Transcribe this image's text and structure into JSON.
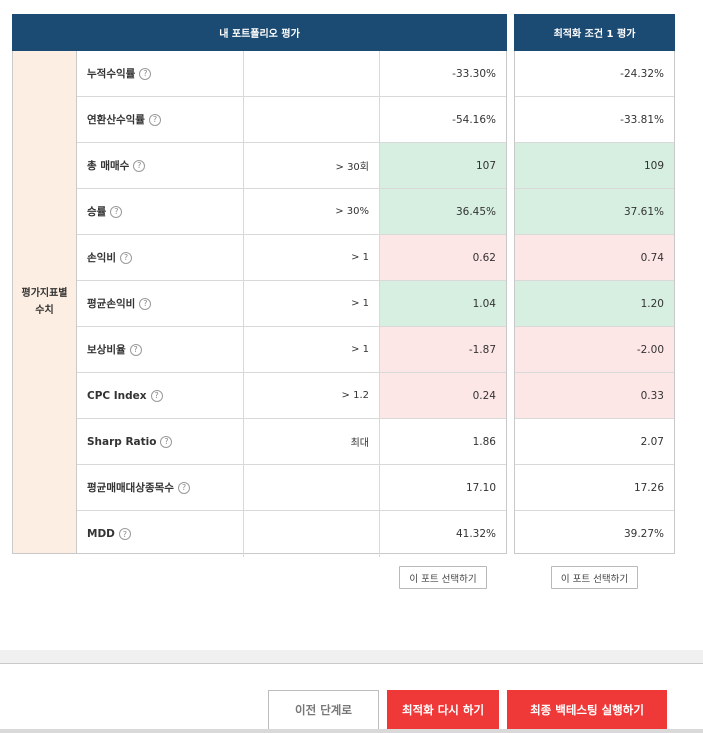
{
  "headers": {
    "my_portfolio": "내 포트폴리오 평가",
    "optimized": "최적화 조건 1 평가"
  },
  "side_label": "평가지표별\n수치",
  "help_glyph": "?",
  "rows": [
    {
      "name": "누적수익률",
      "criteria": "",
      "value": "-33.30%",
      "opt_value": "-24.32%",
      "color": ""
    },
    {
      "name": "연환산수익률",
      "criteria": "",
      "value": "-54.16%",
      "opt_value": "-33.81%",
      "color": ""
    },
    {
      "name": "총 매매수",
      "criteria": "> 30회",
      "value": "107",
      "opt_value": "109",
      "color": "green"
    },
    {
      "name": "승률",
      "criteria": "> 30%",
      "value": "36.45%",
      "opt_value": "37.61%",
      "color": "green"
    },
    {
      "name": "손익비",
      "criteria": "> 1",
      "value": "0.62",
      "opt_value": "0.74",
      "color": "red"
    },
    {
      "name": "평균손익비",
      "criteria": "> 1",
      "value": "1.04",
      "opt_value": "1.20",
      "color": "green"
    },
    {
      "name": "보상비율",
      "criteria": "> 1",
      "value": "-1.87",
      "opt_value": "-2.00",
      "color": "red"
    },
    {
      "name": "CPC Index",
      "criteria": "> 1.2",
      "value": "0.24",
      "opt_value": "0.33",
      "color": "red"
    },
    {
      "name": "Sharp Ratio",
      "criteria": "최대",
      "value": "1.86",
      "opt_value": "2.07",
      "color": ""
    },
    {
      "name": "평균매매대상종목수",
      "criteria": "",
      "value": "17.10",
      "opt_value": "17.26",
      "color": ""
    },
    {
      "name": "MDD",
      "criteria": "",
      "value": "41.32%",
      "opt_value": "39.27%",
      "color": ""
    }
  ],
  "select_buttons": {
    "main": "이 포트 선택하기",
    "optimized": "이 포트 선택하기"
  },
  "footer": {
    "prev": "이전 단계로",
    "reoptimize": "최적화 다시 하기",
    "final_backtest": "최종 백테스팅 실행하기"
  },
  "colors": {
    "header_bg": "#1b4a72",
    "side_bg": "#fdeee3",
    "good_bg": "#d6efe0",
    "bad_bg": "#fde6e6",
    "accent_red": "#ef3838"
  }
}
